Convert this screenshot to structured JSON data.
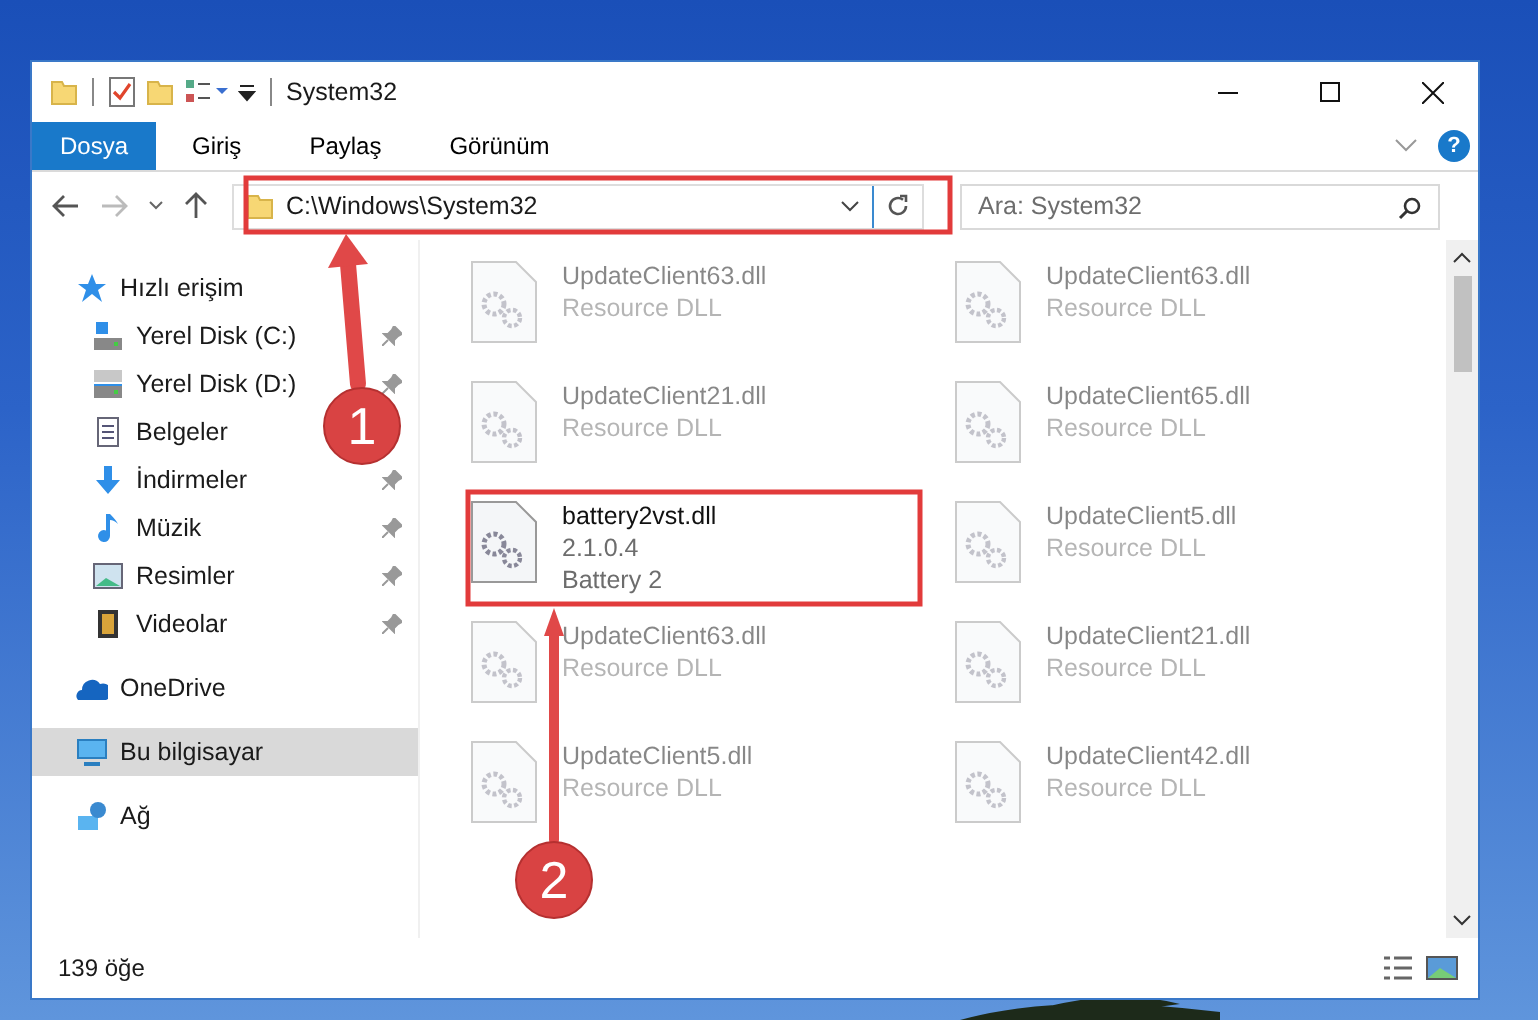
{
  "window": {
    "title": "System32"
  },
  "ribbon": {
    "tabs": [
      {
        "label": "Dosya",
        "kind": "file",
        "selected": false
      },
      {
        "label": "Giriş",
        "kind": "tab",
        "selected": false
      },
      {
        "label": "Paylaş",
        "kind": "tab",
        "selected": false
      },
      {
        "label": "Görünüm",
        "kind": "tab",
        "selected": false
      }
    ],
    "help": "?"
  },
  "address_bar": {
    "path": "C:\\Windows\\System32",
    "search": {
      "placeholder": "Ara: System32"
    }
  },
  "sidebar": {
    "items": [
      {
        "label": "Hızlı erişim",
        "selected": false,
        "children": [
          {
            "label": "Yerel Disk (C:)",
            "pinned": true,
            "selected": false
          },
          {
            "label": "Yerel Disk (D:)",
            "pinned": true,
            "selected": false
          },
          {
            "label": "Belgeler",
            "pinned": false,
            "selected": false
          },
          {
            "label": "İndirmeler",
            "pinned": true,
            "selected": false
          },
          {
            "label": "Müzik",
            "pinned": true,
            "selected": false
          },
          {
            "label": "Resimler",
            "pinned": true,
            "selected": false
          },
          {
            "label": "Videolar",
            "pinned": true,
            "selected": false
          }
        ]
      },
      {
        "label": "OneDrive",
        "selected": false
      },
      {
        "label": "Bu bilgisayar",
        "selected": true
      },
      {
        "label": "Ağ",
        "selected": false
      }
    ]
  },
  "files": [
    {
      "lines": [
        "UpdateClient63.dll",
        "Resource DLL"
      ],
      "faded": true
    },
    {
      "lines": [
        "UpdateClient63.dll",
        "Resource DLL"
      ],
      "faded": true
    },
    {
      "lines": [
        "UpdateClient21.dll",
        "Resource DLL"
      ],
      "faded": true
    },
    {
      "lines": [
        "UpdateClient65.dll",
        "Resource DLL"
      ],
      "faded": true
    },
    {
      "lines": [
        "battery2vst.dll",
        "2.1.0.4",
        "Battery 2"
      ],
      "faded": false
    },
    {
      "lines": [
        "UpdateClient5.dll",
        "Resource DLL"
      ],
      "faded": true
    },
    {
      "lines": [
        "UpdateClient63.dll",
        "Resource DLL"
      ],
      "faded": true
    },
    {
      "lines": [
        "UpdateClient21.dll",
        "Resource DLL"
      ],
      "faded": true
    },
    {
      "lines": [
        "UpdateClient5.dll",
        "Resource DLL"
      ],
      "faded": true
    },
    {
      "lines": [
        "UpdateClient42.dll",
        "Resource DLL"
      ],
      "faded": true
    }
  ],
  "status_bar": {
    "count": "139 öğe"
  },
  "annotations": [
    {
      "label": "1"
    },
    {
      "label": "2"
    }
  ]
}
